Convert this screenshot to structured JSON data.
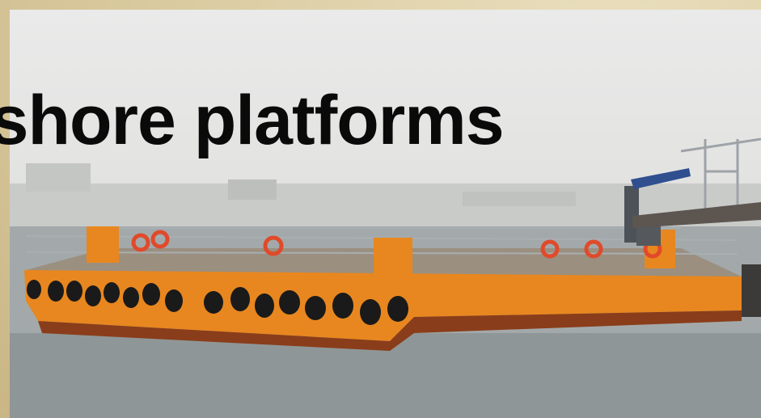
{
  "slide": {
    "title": "fshore platforms"
  },
  "photo": {
    "subject": "orange-barge-photo"
  },
  "colors": {
    "frame": "#d8c9a2",
    "sky": "#e4e4e2",
    "water": "#9aa1a2",
    "hull": "#e8871f",
    "tire": "#1a1a1a",
    "crane": "#2f4f8f"
  }
}
